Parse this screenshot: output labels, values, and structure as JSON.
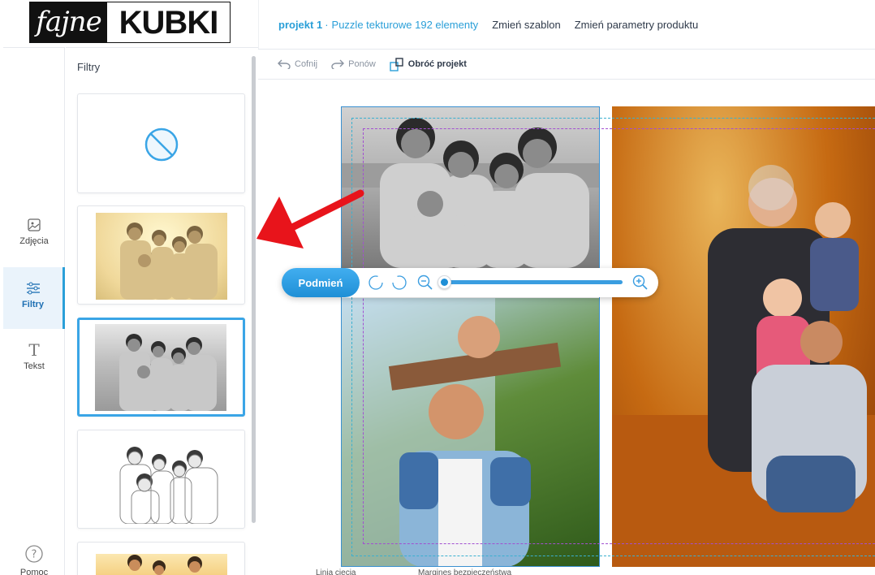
{
  "logo": {
    "script": "fajne",
    "bold": "KUBKI"
  },
  "header": {
    "project": "projekt 1",
    "separator": "·",
    "product": "Puzzle tekturowe 192 elementy",
    "change_template": "Zmień szablon",
    "change_params": "Zmień parametry produktu"
  },
  "toolbar": {
    "undo": "Cofnij",
    "redo": "Ponów",
    "rotate": "Obróć projekt"
  },
  "rail": [
    {
      "label": "Zdjęcia",
      "icon": "image-icon",
      "active": false
    },
    {
      "label": "Filtry",
      "icon": "sliders-icon",
      "active": true
    },
    {
      "label": "Tekst",
      "icon": "text-icon",
      "active": false
    },
    {
      "label": "Pomoc",
      "icon": "help-icon",
      "active": false
    }
  ],
  "panel": {
    "title": "Filtry",
    "filters": [
      {
        "name": "none",
        "icon": "no-filter-icon",
        "selected": false
      },
      {
        "name": "sepia",
        "selected": false
      },
      {
        "name": "grayscale",
        "selected": true
      },
      {
        "name": "sketch",
        "selected": false
      },
      {
        "name": "original",
        "selected": false
      }
    ]
  },
  "editor": {
    "replace_label": "Podmień",
    "zoom_level": 0.0
  },
  "footer": {
    "cut_line": "Linia cięcia",
    "safety_margin": "Margines bezpieczeństwa"
  },
  "colors": {
    "accent": "#2a9fd8",
    "arrow": "#e8141b",
    "cut_line": "#a24fd1",
    "safety_line": "#3ab0d0"
  }
}
